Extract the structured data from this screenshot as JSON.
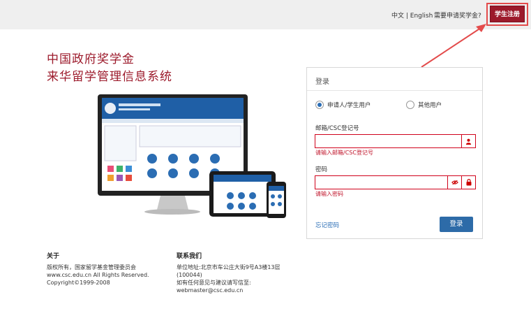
{
  "topbar": {
    "lang_zh": "中文",
    "lang_sep": " | ",
    "lang_en": "English",
    "apply_link": "需要申请奖学金?",
    "register_button": "学生注册"
  },
  "header": {
    "title_line1": "中国政府奖学金",
    "title_line2": "来华留学管理信息系统"
  },
  "login": {
    "panel_title": "登录",
    "user_types": [
      "申请人/学生用户",
      "其他用户"
    ],
    "selected_user_type": "申请人/学生用户",
    "email_label": "邮箱/CSC登记号",
    "email_value": "",
    "email_error": "请输入邮箱/CSC登记号",
    "password_label": "密码",
    "password_value": "",
    "password_error": "请输入密码",
    "forgot_link": "忘记密码",
    "login_button": "登录"
  },
  "footer": {
    "about_title": "关于",
    "about_lines": [
      "版权所有，国家留学基金管理委员会",
      "www.csc.edu.cn All Rights Reserved.",
      "Copyright©1999-2008"
    ],
    "contact_title": "联系我们",
    "contact_lines": [
      "单位地址:北京市车公庄大街9号A3楼13层",
      "(100044)",
      "如有任何意见与建议请写信至:",
      "webmaster@csc.edu.cn"
    ]
  },
  "colors": {
    "brand": "#9c1a2b",
    "accent_blue": "#2d6ba8",
    "error": "#c0152b",
    "annotation": "#e34b4b"
  }
}
